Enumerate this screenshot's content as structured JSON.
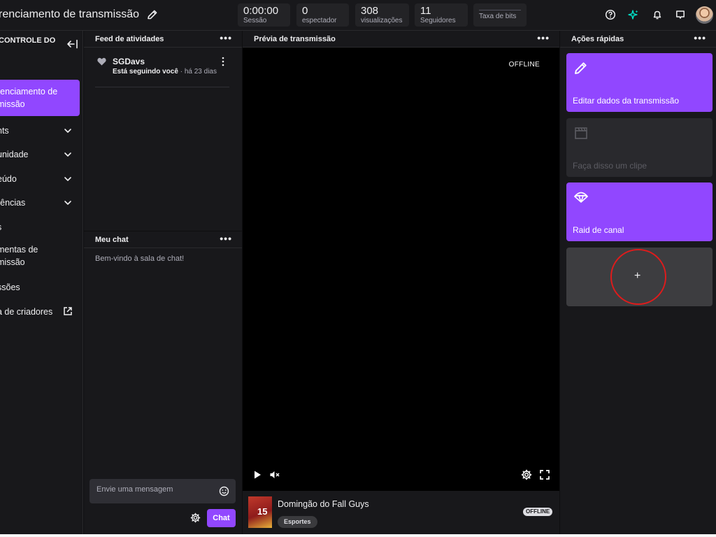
{
  "header": {
    "title": "renciamento de transmissão",
    "stats": [
      {
        "value": "0:00:00",
        "label": "Sessão"
      },
      {
        "value": "0",
        "label": "espectador"
      },
      {
        "value": "308",
        "label": "visualizações"
      },
      {
        "value": "11",
        "label": "Seguidores"
      },
      {
        "value": "",
        "label": "Taxa de bits"
      }
    ],
    "icons": [
      "help-icon",
      "sparkle-icon",
      "bell-icon",
      "inbox-icon"
    ]
  },
  "sidebar": {
    "title": "CONTROLE DO",
    "items": [
      {
        "label": "renciamento de\nmissão"
      },
      {
        "label": "nts"
      },
      {
        "label": "unidade"
      },
      {
        "label": "eúdo"
      },
      {
        "label": "rências"
      },
      {
        "label": "s"
      },
      {
        "label": "mentas de\nmissão"
      },
      {
        "label": "ssões"
      },
      {
        "label": "a de criadores"
      }
    ]
  },
  "activity_feed": {
    "title": "Feed de atividades",
    "items": [
      {
        "name": "SGDavs",
        "action": "Está seguindo você",
        "separator": "·",
        "time": "há 23 dias"
      }
    ]
  },
  "chat": {
    "title": "Meu chat",
    "welcome": "Bem-vindo à sala de chat!",
    "placeholder": "Envie uma mensagem",
    "send_label": "Chat"
  },
  "preview": {
    "title": "Prévia de transmissão",
    "status": "OFFLINE",
    "stream_title": "Domingão do Fall Guys",
    "category": "Esportes",
    "thumb_number": "15",
    "status_pill": "OFFLINE"
  },
  "quick_actions": {
    "title": "Ações rápidas",
    "cards": [
      {
        "label": "Editar dados da transmissão",
        "icon": "pencil-icon",
        "state": "active"
      },
      {
        "label": "Faça disso um clipe",
        "icon": "clapper-icon",
        "state": "disabled"
      },
      {
        "label": "Raid de canal",
        "icon": "parachute-icon",
        "state": "active"
      }
    ],
    "add_label": "+"
  },
  "colors": {
    "accent": "#9147ff",
    "background": "#18181b",
    "highlight_ring": "#e01b1b"
  }
}
